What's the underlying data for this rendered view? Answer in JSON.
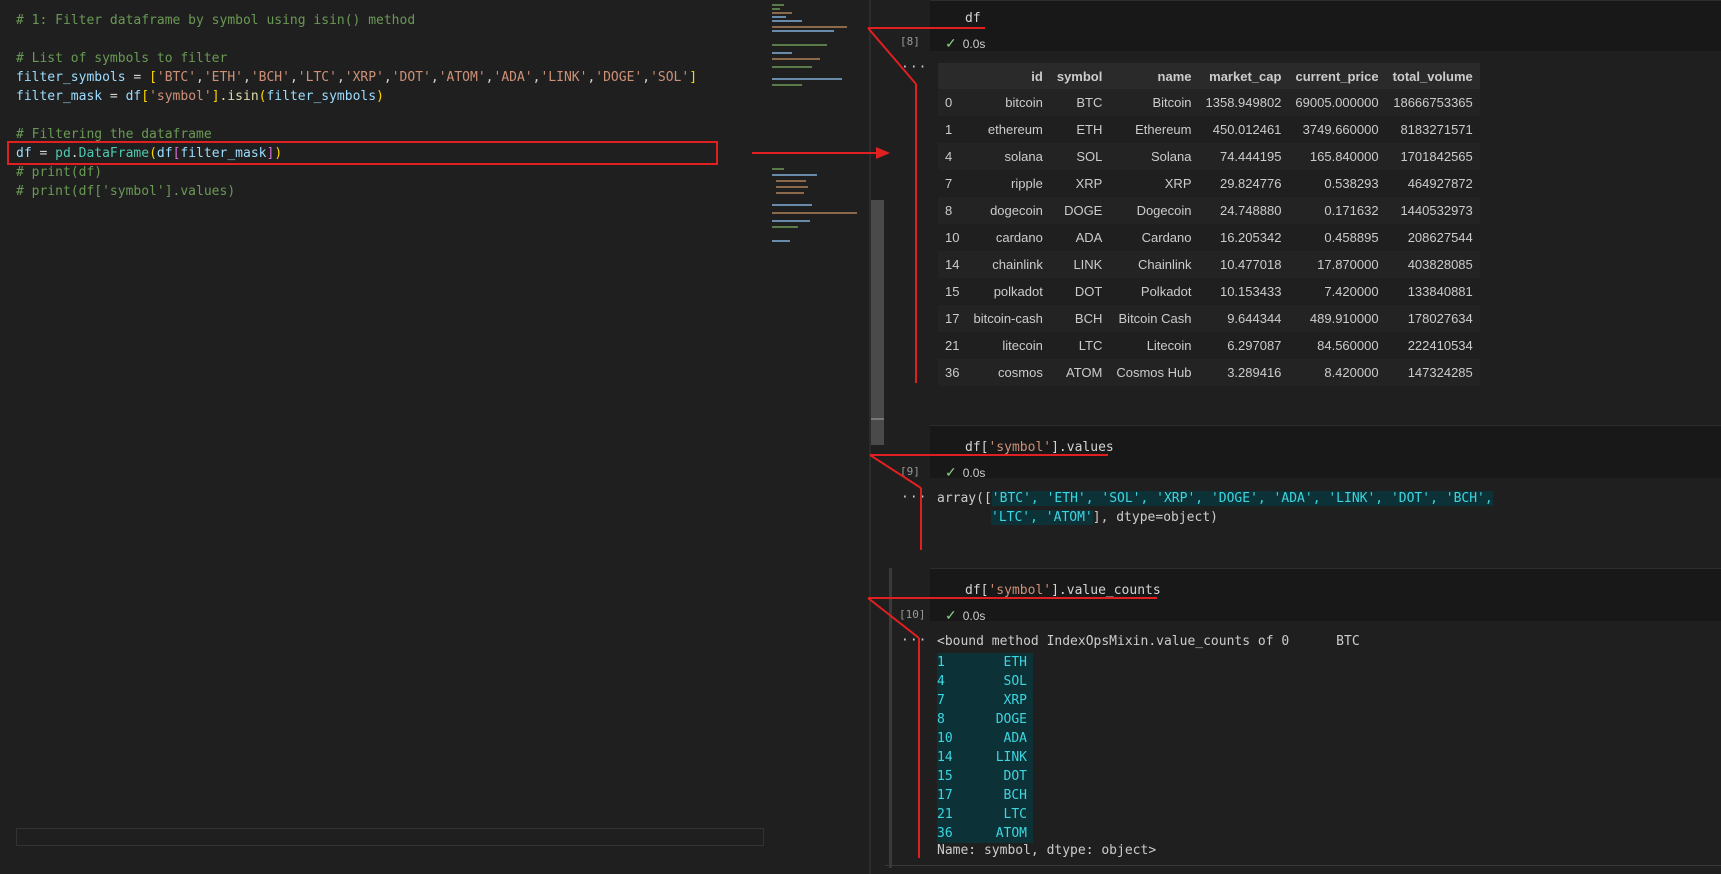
{
  "editor": {
    "lines": [
      {
        "type": "comment",
        "text": "# 1: Filter dataframe by symbol using isin() method"
      },
      {
        "type": "comment",
        "text": "# List of symbols to filter"
      },
      {
        "type": "comment",
        "text": "# Filtering the dataframe"
      },
      {
        "type": "comment",
        "text": "# print(df)"
      },
      {
        "type": "comment",
        "text": "# print(df['symbol'].values)"
      }
    ],
    "symbols_line": {
      "var": "filter_symbols",
      "op": " = ",
      "items": [
        "'BTC'",
        "'ETH'",
        "'BCH'",
        "'LTC'",
        "'XRP'",
        "'DOT'",
        "'ATOM'",
        "'ADA'",
        "'LINK'",
        "'DOGE'",
        "'SOL'"
      ]
    },
    "mask_line": {
      "var": "filter_mask",
      "op": " = ",
      "df": "df",
      "key": "'symbol'",
      "method": ".isin",
      "arg": "filter_symbols"
    },
    "df_line": {
      "var": "df",
      "op": " = ",
      "mod": "pd",
      "cls": "DataFrame",
      "df": "df",
      "arg": "filter_mask"
    }
  },
  "cells": [
    {
      "exec_count": "[8]",
      "code": "df",
      "status": "0.0s",
      "output_dots": "···",
      "table": {
        "columns": [
          "",
          "id",
          "symbol",
          "name",
          "market_cap",
          "current_price",
          "total_volume"
        ],
        "rows": [
          [
            "0",
            "bitcoin",
            "BTC",
            "Bitcoin",
            "1358.949802",
            "69005.000000",
            "18666753365"
          ],
          [
            "1",
            "ethereum",
            "ETH",
            "Ethereum",
            "450.012461",
            "3749.660000",
            "8183271571"
          ],
          [
            "4",
            "solana",
            "SOL",
            "Solana",
            "74.444195",
            "165.840000",
            "1701842565"
          ],
          [
            "7",
            "ripple",
            "XRP",
            "XRP",
            "29.824776",
            "0.538293",
            "464927872"
          ],
          [
            "8",
            "dogecoin",
            "DOGE",
            "Dogecoin",
            "24.748880",
            "0.171632",
            "1440532973"
          ],
          [
            "10",
            "cardano",
            "ADA",
            "Cardano",
            "16.205342",
            "0.458895",
            "208627544"
          ],
          [
            "14",
            "chainlink",
            "LINK",
            "Chainlink",
            "10.477018",
            "17.870000",
            "403828085"
          ],
          [
            "15",
            "polkadot",
            "DOT",
            "Polkadot",
            "10.153433",
            "7.420000",
            "133840881"
          ],
          [
            "17",
            "bitcoin-cash",
            "BCH",
            "Bitcoin Cash",
            "9.644344",
            "489.910000",
            "178027634"
          ],
          [
            "21",
            "litecoin",
            "LTC",
            "Litecoin",
            "6.297087",
            "84.560000",
            "222410534"
          ],
          [
            "36",
            "cosmos",
            "ATOM",
            "Cosmos Hub",
            "3.289416",
            "8.420000",
            "147324285"
          ]
        ]
      }
    },
    {
      "exec_count": "[9]",
      "code_pre": "df[",
      "code_str": "'symbol'",
      "code_post": "].values",
      "status": "0.0s",
      "output_dots": "···",
      "out_line1_pre": "array([",
      "out_line1_hl": "'BTC', 'ETH', 'SOL', 'XRP', 'DOGE', 'ADA', 'LINK', 'DOT', 'BCH',",
      "out_line2_hl": "'LTC', 'ATOM'",
      "out_line2_post": "], dtype=object)"
    },
    {
      "exec_count": "[10]",
      "code_pre": "df[",
      "code_str": "'symbol'",
      "code_post": "].value_counts",
      "status": "0.0s",
      "output_dots": "···",
      "out_first": "<bound method IndexOpsMixin.value_counts of 0      BTC",
      "out_rows": [
        {
          "idx": "1",
          "val": "ETH"
        },
        {
          "idx": "4",
          "val": "SOL"
        },
        {
          "idx": "7",
          "val": "XRP"
        },
        {
          "idx": "8",
          "val": "DOGE"
        },
        {
          "idx": "10",
          "val": "ADA"
        },
        {
          "idx": "14",
          "val": "LINK"
        },
        {
          "idx": "15",
          "val": "DOT"
        },
        {
          "idx": "17",
          "val": "BCH"
        },
        {
          "idx": "21",
          "val": "LTC"
        },
        {
          "idx": "36",
          "val": "ATOM"
        }
      ],
      "out_last": "Name: symbol, dtype: object>"
    }
  ],
  "colors": {
    "annotation": "#e02020",
    "highlight_bg": "#0c3237",
    "highlight_fg": "#3dd6e0",
    "success": "#89d185"
  }
}
